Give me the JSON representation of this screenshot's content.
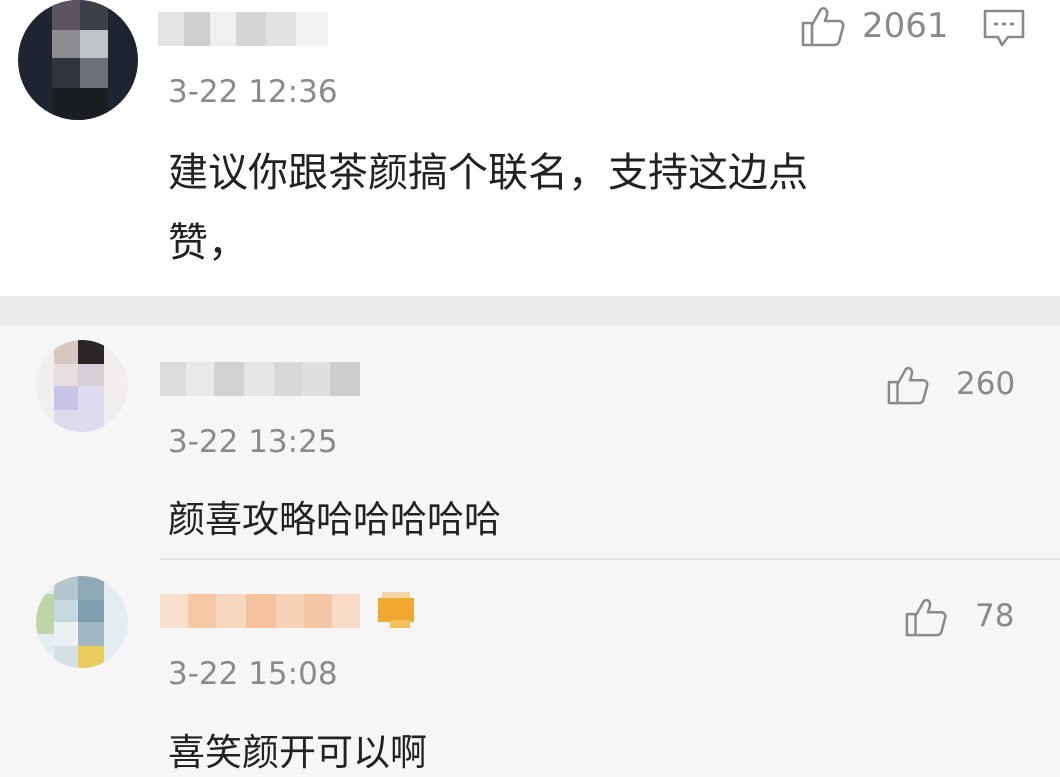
{
  "main_comment": {
    "timestamp": "3-22 12:36",
    "text_line1": "建议你跟茶颜搞个联名，支持这边点",
    "text_line2": "赞，",
    "likes": "2061"
  },
  "replies": [
    {
      "timestamp": "3-22 13:25",
      "text": "颜喜攻略哈哈哈哈哈",
      "likes": "260"
    },
    {
      "timestamp": "3-22 15:08",
      "text": "喜笑颜开可以啊",
      "likes": "78"
    }
  ],
  "icons": {
    "like": "thumbs-up-icon",
    "reply": "comment-bubble-icon",
    "badge": "user-badge-icon"
  },
  "colors": {
    "text": "#222222",
    "meta": "#8a8a8a",
    "reply_background": "#f6f6f6",
    "divider": "#ececec"
  }
}
